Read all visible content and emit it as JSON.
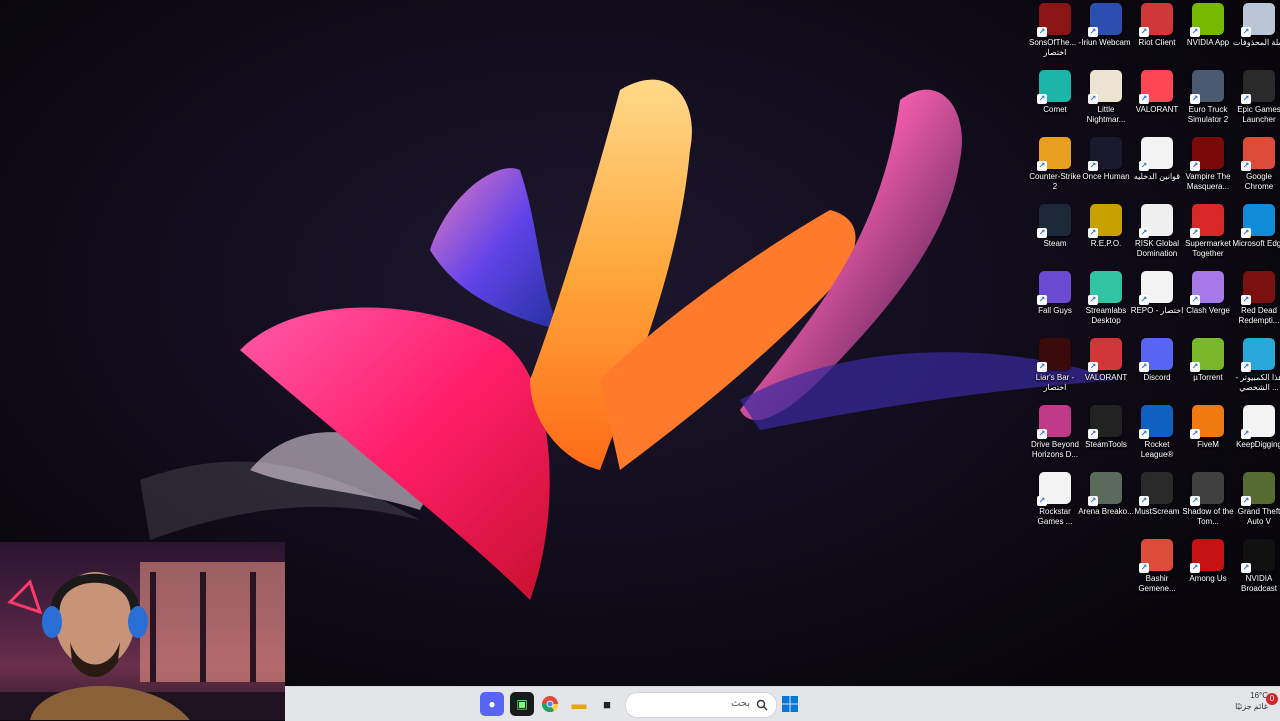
{
  "desktop": {
    "icons": [
      {
        "label": "سلة المحذوفات",
        "icon": "recycle-bin-icon",
        "color": "#b8c6d6"
      },
      {
        "label": "NVIDIA App",
        "icon": "nvidia-app-icon",
        "color": "#76b900"
      },
      {
        "label": "Riot Client",
        "icon": "riot-client-icon",
        "color": "#d13639"
      },
      {
        "label": "Iriun Webcam",
        "icon": "iriun-webcam-icon",
        "color": "#2b4fb0"
      },
      {
        "label": "SonsOfThe... - اختصار",
        "icon": "sons-of-the-forest-icon",
        "color": "#8b1414"
      },
      {
        "label": "Epic Games Launcher",
        "icon": "epic-games-icon",
        "color": "#2a2a2a"
      },
      {
        "label": "Euro Truck Simulator 2",
        "icon": "euro-truck-icon",
        "color": "#4a5a70"
      },
      {
        "label": "VALORANT",
        "icon": "valorant-icon",
        "color": "#ff4655"
      },
      {
        "label": "Little Nightmar...",
        "icon": "little-nightmares-icon",
        "color": "#ece4d0"
      },
      {
        "label": "Comet",
        "icon": "comet-icon",
        "color": "#1db5a8"
      },
      {
        "label": "Google Chrome",
        "icon": "chrome-icon",
        "color": "#dd4b39"
      },
      {
        "label": "Vampire The Masquera...",
        "icon": "vampire-masquerade-icon",
        "color": "#7a0a0a"
      },
      {
        "label": "قوانين الدخليه",
        "icon": "document-icon",
        "color": "#f3f3f3"
      },
      {
        "label": "Once Human",
        "icon": "once-human-icon",
        "color": "#1a1a2e"
      },
      {
        "label": "Counter-Strike 2",
        "icon": "counter-strike-icon",
        "color": "#e8a020"
      },
      {
        "label": "Microsoft Edge",
        "icon": "edge-icon",
        "color": "#0f8bd8"
      },
      {
        "label": "Supermarket Together",
        "icon": "supermarket-together-icon",
        "color": "#d82828"
      },
      {
        "label": "RISK Global Domination",
        "icon": "risk-icon",
        "color": "#f0f0f0"
      },
      {
        "label": "R.E.P.O.",
        "icon": "repo-icon",
        "color": "#c8a000"
      },
      {
        "label": "Steam",
        "icon": "steam-icon",
        "color": "#1b2838"
      },
      {
        "label": "Red Dead Redempti...",
        "icon": "red-dead-icon",
        "color": "#7a1010"
      },
      {
        "label": "Clash Verge",
        "icon": "clash-verge-icon",
        "color": "#a678e8"
      },
      {
        "label": "REPO - اختصار",
        "icon": "repo-shortcut-icon",
        "color": "#f3f3f3"
      },
      {
        "label": "Streamlabs Desktop",
        "icon": "streamlabs-icon",
        "color": "#31c3a2"
      },
      {
        "label": "Fall Guys",
        "icon": "fall-guys-icon",
        "color": "#6a4ad0"
      },
      {
        "label": "هذا الكمبيوتر - الشخصي ...",
        "icon": "this-pc-icon",
        "color": "#27a8d8"
      },
      {
        "label": "µTorrent",
        "icon": "utorrent-icon",
        "color": "#78b82a"
      },
      {
        "label": "Discord",
        "icon": "discord-icon",
        "color": "#5865f2"
      },
      {
        "label": "VALORANT",
        "icon": "valorant-2-icon",
        "color": "#d13639"
      },
      {
        "label": "Liar's Bar - اختصار",
        "icon": "liars-bar-icon",
        "color": "#3a0a0a"
      },
      {
        "label": "KeepDigging",
        "icon": "keepdigging-icon",
        "color": "#f3f3f3"
      },
      {
        "label": "FiveM",
        "icon": "fivem-icon",
        "color": "#f07a10"
      },
      {
        "label": "Rocket League®",
        "icon": "rocket-league-icon",
        "color": "#1060c0"
      },
      {
        "label": "SteamTools",
        "icon": "steamtools-icon",
        "color": "#222222"
      },
      {
        "label": "Drive Beyond Horizons D...",
        "icon": "drive-beyond-icon",
        "color": "#c03a8a"
      },
      {
        "label": "Grand Theft Auto V",
        "icon": "gta-v-icon",
        "color": "#556b2f"
      },
      {
        "label": "Shadow of the Tom...",
        "icon": "shadow-tomb-raider-icon",
        "color": "#404040"
      },
      {
        "label": "MustScream",
        "icon": "mustscream-icon",
        "color": "#2a2a2a"
      },
      {
        "label": "Arena Breako...",
        "icon": "arena-breakout-icon",
        "color": "#5a6a5a"
      },
      {
        "label": "Rockstar Games ...",
        "icon": "rockstar-icon",
        "color": "#f3f3f3"
      },
      {
        "label": "NVIDIA Broadcast",
        "icon": "nvidia-broadcast-icon",
        "color": "#111111"
      },
      {
        "label": "Among Us",
        "icon": "among-us-icon",
        "color": "#c51111"
      },
      {
        "label": "Bashir Gemene...",
        "icon": "chrome-profile-icon",
        "color": "#dd4b39"
      }
    ]
  },
  "taskbar": {
    "search_placeholder": "بحث",
    "temperature": "16°C",
    "weather_text": "غائم جزئيًا",
    "notification_count": "0"
  }
}
